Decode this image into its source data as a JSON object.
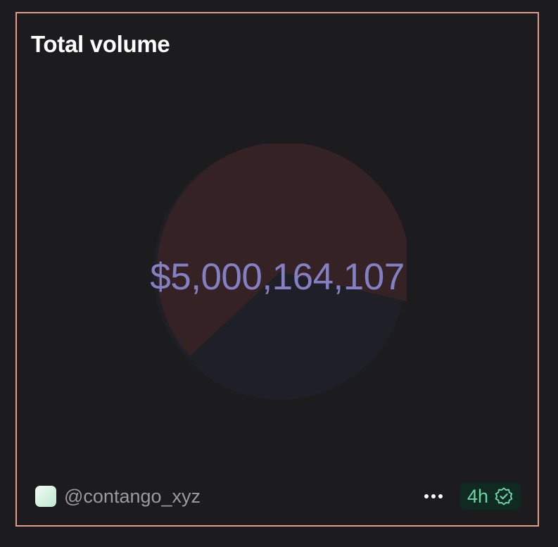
{
  "card": {
    "title": "Total volume",
    "value": "$5,000,164,107"
  },
  "pie": {
    "slices": [
      {
        "fraction": 0.67,
        "color": "#352224"
      },
      {
        "fraction": 0.33,
        "color": "#1f1f27"
      }
    ]
  },
  "footer": {
    "author_handle": "@contango_xyz",
    "refresh_interval": "4h",
    "more_icon": "ellipsis-icon",
    "verified_icon": "verified-badge-icon"
  },
  "colors": {
    "card_border": "#e59a8c",
    "value_text": "#8381c4",
    "badge_text": "#6ed3a3",
    "badge_bg": "#0e2a21"
  }
}
